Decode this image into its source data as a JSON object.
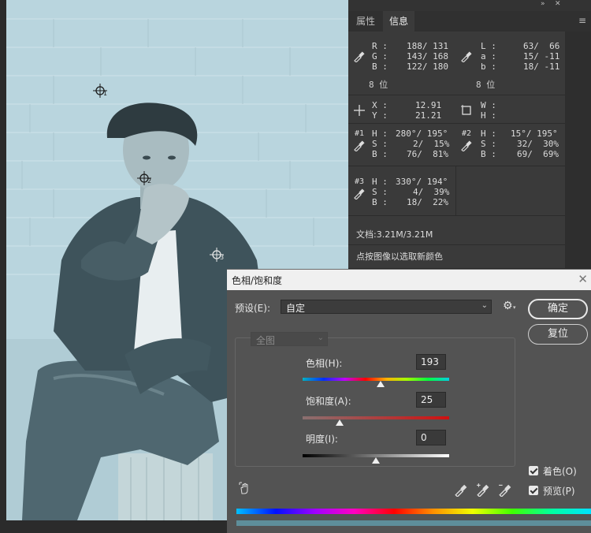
{
  "info_panel": {
    "topbar": {
      "collapse": "»",
      "close": "✕"
    },
    "tabs": [
      "属性",
      "信息"
    ],
    "menu_icon": "≡",
    "rgb": {
      "labels": [
        "R :",
        "G :",
        "B :"
      ],
      "values": [
        "188/ 131",
        "143/ 168",
        "122/ 180"
      ]
    },
    "lab": {
      "labels": [
        "L :",
        "a :",
        "b :"
      ],
      "values": [
        "63/  66",
        "15/ -11",
        "18/ -11"
      ]
    },
    "bit_left": "8 位",
    "bit_right": "8 位",
    "xy": {
      "labels": [
        "X :",
        "Y :"
      ],
      "values": [
        "12.91",
        "21.21"
      ]
    },
    "wh": {
      "labels": [
        "W :",
        "H :"
      ]
    },
    "s1": {
      "id": "#1",
      "labels": [
        "H :",
        "S :",
        "B :"
      ],
      "values": [
        "280°/ 195°",
        "2/  15%",
        "76/  81%"
      ]
    },
    "s2": {
      "id": "#2",
      "labels": [
        "H :",
        "S :",
        "B :"
      ],
      "values": [
        "15°/ 195°",
        "32/  30%",
        "69/  69%"
      ]
    },
    "s3": {
      "id": "#3",
      "labels": [
        "H :",
        "S :",
        "B :"
      ],
      "values": [
        "330°/ 194°",
        "4/  39%",
        "18/  22%"
      ]
    },
    "doc": "文档:3.21M/3.21M",
    "hint": "点按图像以选取新颜色"
  },
  "samplers": [
    "1",
    "2",
    "3"
  ],
  "dialog": {
    "title": "色相/饱和度",
    "close": "✕",
    "preset_label": "预设(E):",
    "preset_value": "自定",
    "gear": "⚙",
    "ok": "确定",
    "reset": "复位",
    "channel": "全图",
    "hue_label": "色相(H):",
    "hue_value": "193",
    "hue_pct": 0.53,
    "sat_label": "饱和度(A):",
    "sat_value": "25",
    "sat_pct": 0.25,
    "light_label": "明度(I):",
    "light_value": "0",
    "light_pct": 0.5,
    "colorize_label": "着色(O)",
    "preview_label": "预览(P)",
    "colorize_checked": true,
    "preview_checked": true
  },
  "icons": [
    "eyedropper-icon",
    "crosshair-icon",
    "selection-size-icon",
    "gear-icon",
    "hand-adjust-icon",
    "eyedropper-plus-icon",
    "eyedropper-minus-icon"
  ]
}
